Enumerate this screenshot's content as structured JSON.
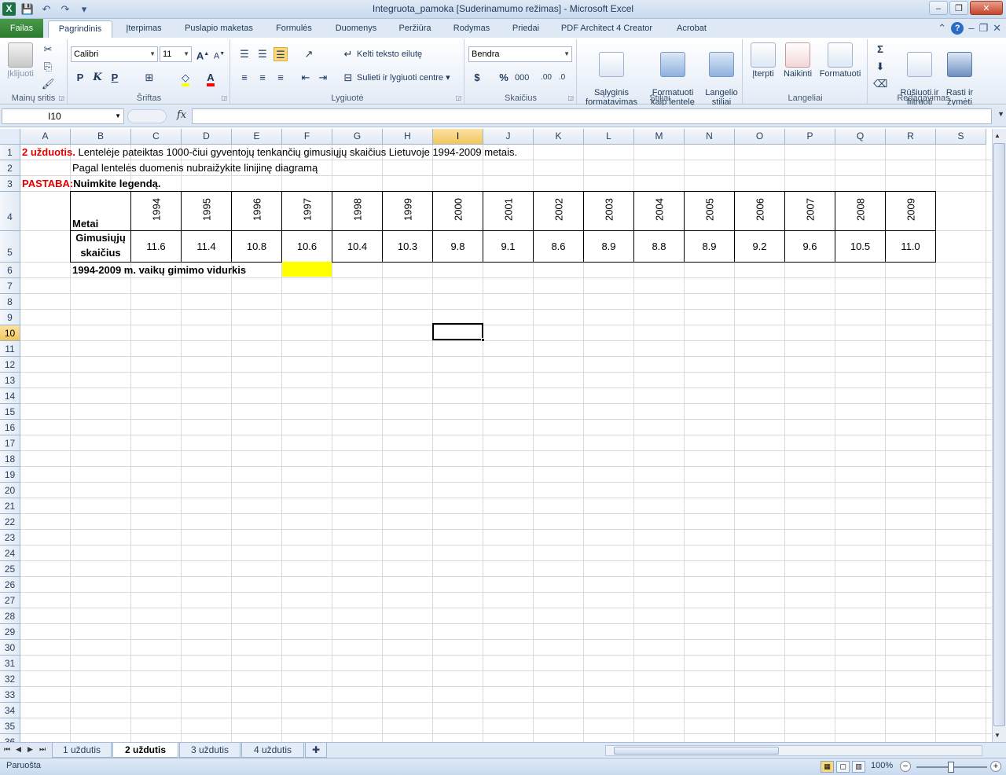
{
  "window": {
    "app_icon": "X",
    "title": "Integruota_pamoka  [Suderinamumo režimas]  -  Microsoft Excel",
    "minimize": "–",
    "restore": "❐",
    "close": "✕"
  },
  "ribbon_tabs": [
    "Failas",
    "Pagrindinis",
    "Įterpimas",
    "Puslapio maketas",
    "Formulės",
    "Duomenys",
    "Peržiūra",
    "Rodymas",
    "Priedai",
    "PDF Architect 4 Creator",
    "Acrobat"
  ],
  "ribbon": {
    "clipboard": {
      "paste": "Įklijuoti",
      "label": "Mainų sritis"
    },
    "font": {
      "name": "Calibri",
      "size": "11",
      "bold": "P",
      "italic": "K",
      "underline": "P",
      "label": "Šriftas"
    },
    "alignment": {
      "wrap": "Kelti teksto eilutę",
      "merge": "Sulieti ir lygiuoti centre",
      "label": "Lygiuotė"
    },
    "number": {
      "format": "Bendra",
      "currency": "$",
      "percent": "%",
      "thousands": "000",
      "label": "Skaičius"
    },
    "styles": {
      "conditional": "Sąlyginis\nformatavimas",
      "as_table": "Formatuoti\nkaip lentelę",
      "cell_styles": "Langelio\nstiliai",
      "label": "Stiliai"
    },
    "cells": {
      "insert": "Įterpti",
      "delete": "Naikinti",
      "format": "Formatuoti",
      "label": "Langeliai"
    },
    "editing": {
      "sort": "Rūšiuoti ir\nfiltruoti",
      "find": "Rasti ir\nžymėti",
      "label": "Redagavimas"
    }
  },
  "formula_bar": {
    "name_box": "I10",
    "fx": "fx",
    "formula": ""
  },
  "columns": [
    "A",
    "B",
    "C",
    "D",
    "E",
    "F",
    "G",
    "H",
    "I",
    "J",
    "K",
    "L",
    "M",
    "N",
    "O",
    "P",
    "Q",
    "R",
    "S"
  ],
  "selected_column": "I",
  "rows": [
    "1",
    "2",
    "3",
    "4",
    "5",
    "6",
    "7",
    "8",
    "9",
    "10",
    "11",
    "12",
    "13",
    "14",
    "15",
    "16",
    "17",
    "18",
    "19",
    "20",
    "21",
    "22",
    "23",
    "24",
    "25",
    "26",
    "27",
    "28",
    "29",
    "30",
    "31",
    "32",
    "33",
    "34",
    "35",
    "36"
  ],
  "selected_row": "10",
  "sheet": {
    "r1_label": "2 užduotis.",
    "r1_text": "Lentelėje pateiktas 1000-čiui gyventojų tenkančių gimusiųjų skaičius Lietuvoje 1994-2009 metais.",
    "r2_text": "Pagal lentelės duomenis nubraižykite linijinę diagramą",
    "r3_label": "PASTABA:",
    "r3_text": "Nuimkite legendą.",
    "table_header_label": "Metai",
    "table_value_label_1": "Gimusiųjų",
    "table_value_label_2": "skaičius",
    "years": [
      "1994",
      "1995",
      "1996",
      "1997",
      "1998",
      "1999",
      "2000",
      "2001",
      "2002",
      "2003",
      "2004",
      "2005",
      "2006",
      "2007",
      "2008",
      "2009"
    ],
    "values": [
      "11.6",
      "11.4",
      "10.8",
      "10.6",
      "10.4",
      "10.3",
      "9.8",
      "9.1",
      "8.6",
      "8.9",
      "8.8",
      "8.9",
      "9.2",
      "9.6",
      "10.5",
      "11.0"
    ],
    "r6_text": "1994-2009 m. vaikų gimimo vidurkis",
    "highlight_color": "#ffff00"
  },
  "sheet_tabs": [
    "1 uždutis",
    "2 uždutis",
    "3 uždutis",
    "4 uždutis"
  ],
  "active_sheet": "2 uždutis",
  "status": {
    "ready": "Paruošta",
    "zoom": "100%"
  }
}
